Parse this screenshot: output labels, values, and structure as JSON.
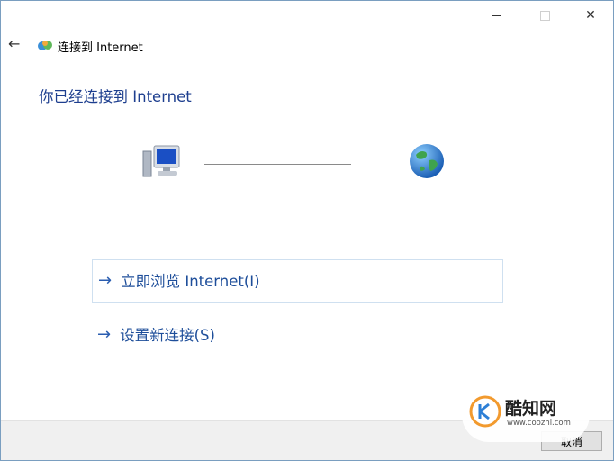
{
  "window": {
    "title": "连接到 Internet"
  },
  "heading": "你已经连接到 Internet",
  "options": [
    {
      "arrow": "→",
      "label": "立即浏览 Internet(I)"
    },
    {
      "arrow": "→",
      "label": "设置新连接(S)"
    }
  ],
  "footer": {
    "cancel_label": "取消"
  },
  "watermark": {
    "name": "酷知网",
    "url": "www.coozhi.com"
  },
  "icons": {
    "back": "back-arrow-icon",
    "app": "network-globe-icon",
    "computer": "computer-icon",
    "globe": "globe-icon"
  },
  "colors": {
    "heading": "#1e3f8f",
    "link": "#1e4e9a",
    "border": "#7a9ec0"
  }
}
